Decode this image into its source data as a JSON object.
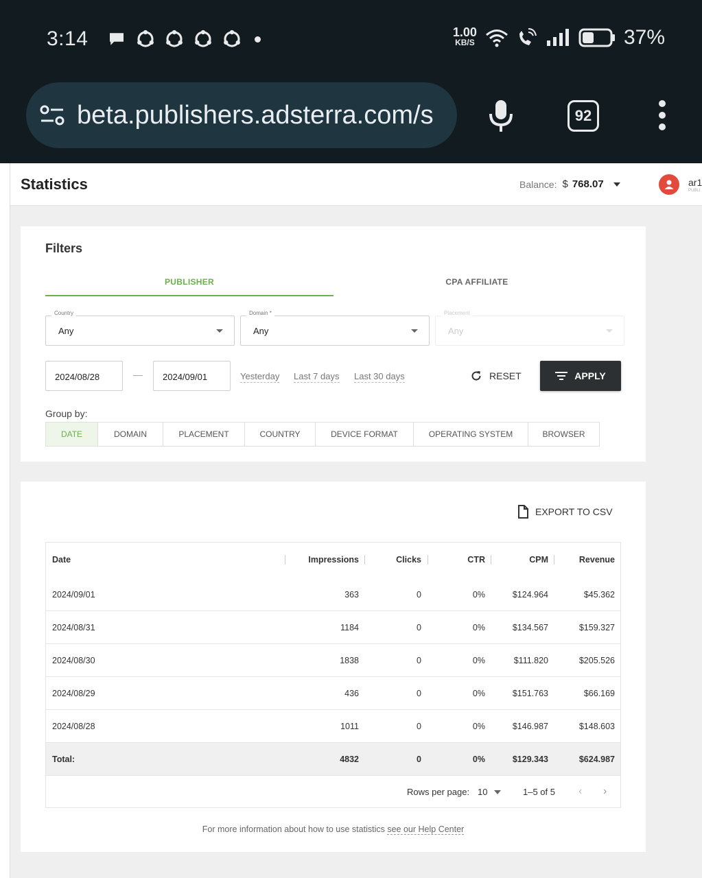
{
  "statusbar": {
    "time": "3:14",
    "speed_value": "1.00",
    "speed_unit": "KB/S",
    "battery": "37%"
  },
  "browser": {
    "url": "beta.publishers.adsterra.com/s",
    "tab_count": "92"
  },
  "header": {
    "title": "Statistics",
    "balance_label": "Balance:",
    "currency": "$",
    "balance_value": "768.07",
    "user_name": "ar1",
    "user_role": "PUBLI"
  },
  "filters": {
    "title": "Filters",
    "tabs": [
      "PUBLISHER",
      "CPA AFFILIATE"
    ],
    "country": {
      "label": "Country",
      "value": "Any"
    },
    "domain": {
      "label": "Domain *",
      "value": "Any"
    },
    "placement": {
      "label": "Placement",
      "value": "Any"
    },
    "date_from": "2024/08/28",
    "date_to": "2024/09/01",
    "quick_ranges": [
      "Yesterday",
      "Last 7 days",
      "Last 30 days"
    ],
    "reset_label": "RESET",
    "apply_label": "APPLY",
    "group_by_label": "Group by:",
    "group_by": [
      "DATE",
      "DOMAIN",
      "PLACEMENT",
      "COUNTRY",
      "DEVICE FORMAT",
      "OPERATING SYSTEM",
      "BROWSER"
    ],
    "group_by_active": "DATE"
  },
  "results": {
    "export_label": "EXPORT TO CSV",
    "columns": [
      "Date",
      "Impressions",
      "Clicks",
      "CTR",
      "CPM",
      "Revenue"
    ],
    "rows": [
      [
        "2024/09/01",
        "363",
        "0",
        "0%",
        "$124.964",
        "$45.362"
      ],
      [
        "2024/08/31",
        "1184",
        "0",
        "0%",
        "$134.567",
        "$159.327"
      ],
      [
        "2024/08/30",
        "1838",
        "0",
        "0%",
        "$111.820",
        "$205.526"
      ],
      [
        "2024/08/29",
        "436",
        "0",
        "0%",
        "$151.763",
        "$66.169"
      ],
      [
        "2024/08/28",
        "1011",
        "0",
        "0%",
        "$146.987",
        "$148.603"
      ]
    ],
    "total": [
      "Total:",
      "4832",
      "0",
      "0%",
      "$129.343",
      "$624.987"
    ],
    "pagination": {
      "rows_per_page_label": "Rows per page:",
      "rows_per_page": "10",
      "range": "1–5 of 5"
    },
    "help_text": "For more information about how to use statistics",
    "help_link": "see our Help Center"
  },
  "colors": {
    "accent_green": "#6ab04c",
    "apply_button": "#2d3033",
    "avatar": "#e24a3b",
    "chrome_dark": "#121b1f"
  }
}
